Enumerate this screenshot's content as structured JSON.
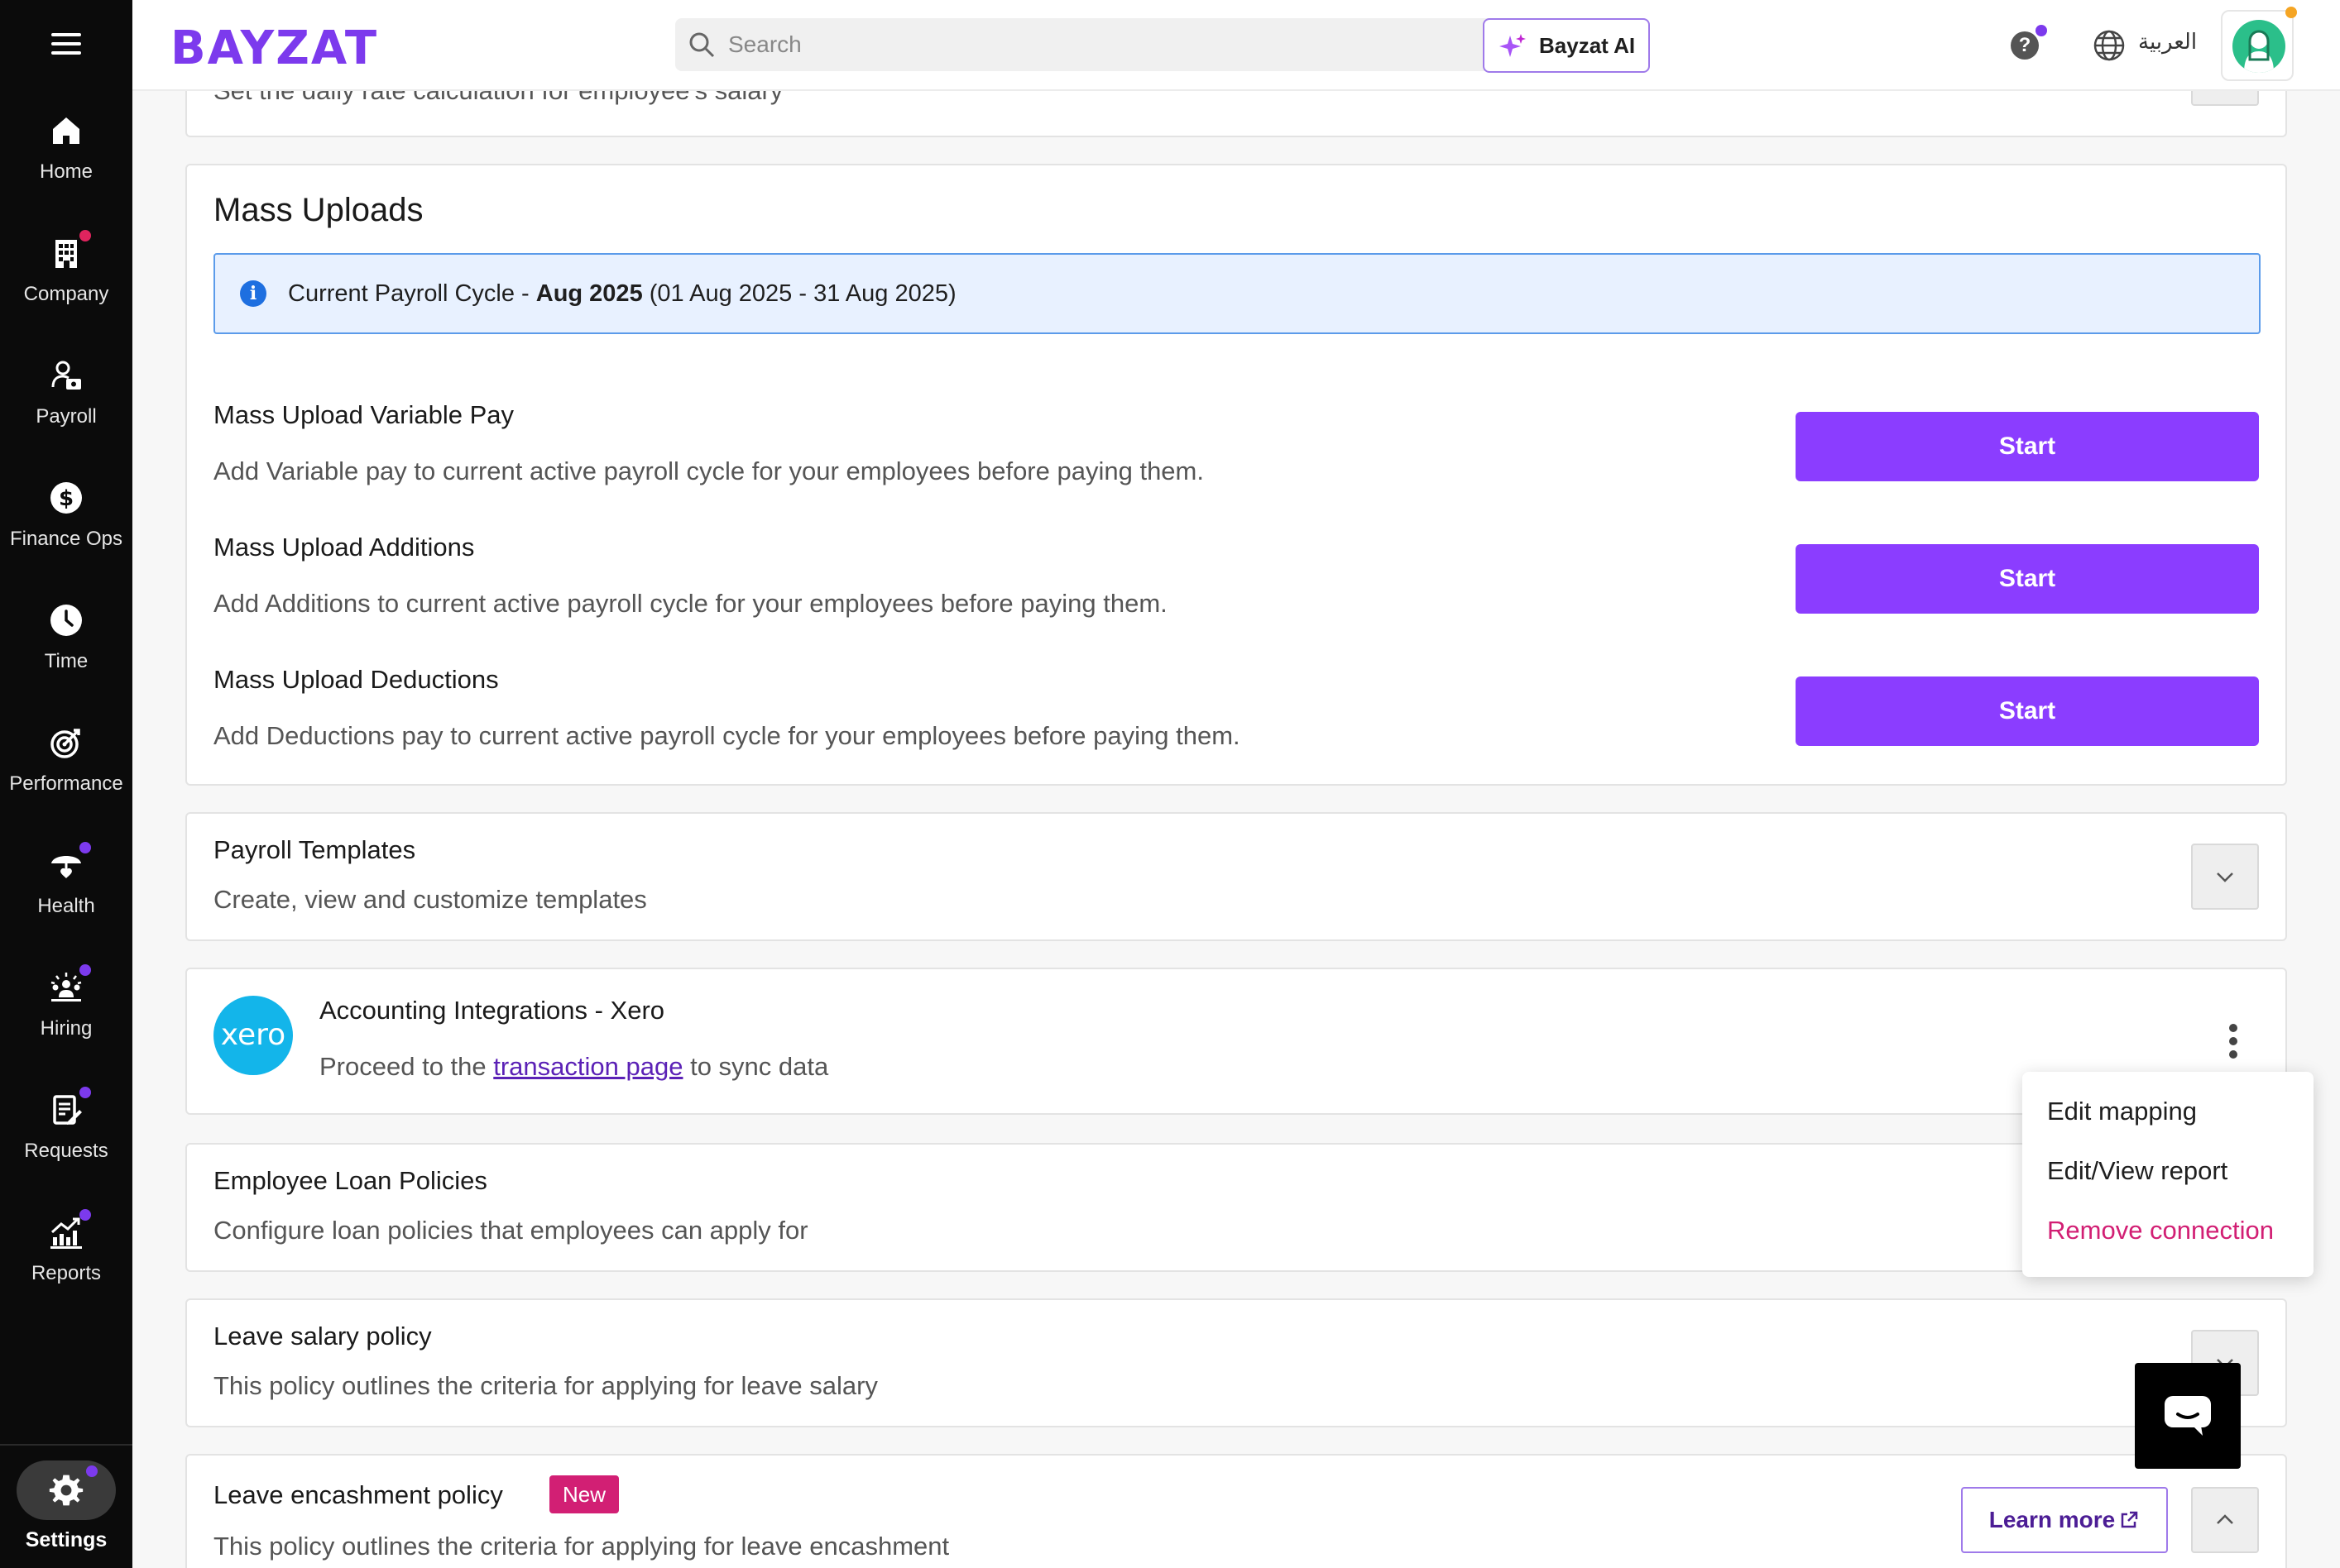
{
  "app": {
    "logo_text": "BAYZAT",
    "brand_color": "#7c3aed"
  },
  "topbar": {
    "search_placeholder": "Search",
    "ai_button": "Bayzat AI",
    "help_label": "?",
    "language": "العربية"
  },
  "sidebar": {
    "items": [
      {
        "label": "Home",
        "icon": "home-icon"
      },
      {
        "label": "Company",
        "icon": "building-icon",
        "dot": "red"
      },
      {
        "label": "Payroll",
        "icon": "payroll-icon"
      },
      {
        "label": "Finance Ops",
        "icon": "dollar-icon"
      },
      {
        "label": "Time",
        "icon": "clock-icon"
      },
      {
        "label": "Performance",
        "icon": "target-icon"
      },
      {
        "label": "Health",
        "icon": "umbrella-heart-icon",
        "dot": "purple"
      },
      {
        "label": "Hiring",
        "icon": "hiring-icon",
        "dot": "purple"
      },
      {
        "label": "Requests",
        "icon": "clipboard-icon",
        "dot": "purple"
      },
      {
        "label": "Reports",
        "icon": "chart-icon",
        "dot": "purple"
      }
    ],
    "settings_label": "Settings"
  },
  "partial_card": {
    "desc": "Set the daily rate calculation for employee's salary"
  },
  "mass_uploads": {
    "title": "Mass Uploads",
    "info_prefix": "Current Payroll Cycle - ",
    "info_cycle": "Aug 2025",
    "info_range": " (01 Aug 2025 - 31 Aug 2025)",
    "items": [
      {
        "title": "Mass Upload Variable Pay",
        "desc": "Add Variable pay to current active payroll cycle for your employees before paying them.",
        "button": "Start"
      },
      {
        "title": "Mass Upload Additions",
        "desc": "Add Additions to current active payroll cycle for your employees before paying them.",
        "button": "Start"
      },
      {
        "title": "Mass Upload Deductions",
        "desc": "Add Deductions pay to current active payroll cycle for your employees before paying them.",
        "button": "Start"
      }
    ]
  },
  "payroll_templates": {
    "title": "Payroll Templates",
    "desc": "Create, view and customize templates"
  },
  "xero": {
    "logo_text": "xero",
    "title": "Accounting Integrations - Xero",
    "desc_prefix": "Proceed to the ",
    "link_text": "transaction page",
    "desc_suffix": " to sync data"
  },
  "context_menu": {
    "items": [
      "Edit mapping",
      "Edit/View report",
      "Remove connection"
    ]
  },
  "loan_policies": {
    "title": "Employee Loan Policies",
    "desc": "Configure loan policies that employees can apply for"
  },
  "leave_salary": {
    "title": "Leave salary policy",
    "desc": "This policy outlines the criteria for applying for leave salary"
  },
  "leave_encashment": {
    "title": "Leave encashment policy",
    "badge": "New",
    "desc": "This policy outlines the criteria for applying for leave encashment",
    "learn_more": "Learn more"
  },
  "colors": {
    "primary_button": "#8b3dff",
    "danger": "#d21f74",
    "info_bg": "#e8f1ff",
    "xero": "#13b5ea"
  }
}
